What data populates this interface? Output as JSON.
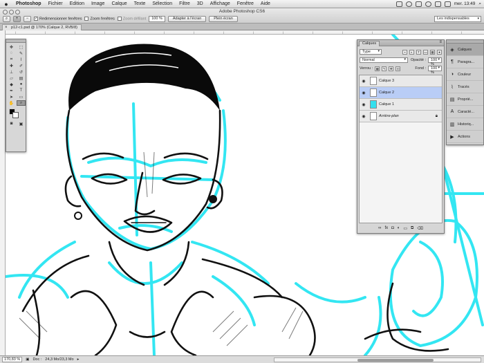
{
  "menubar": {
    "app_name": "Photoshop",
    "items": [
      "Fichier",
      "Edition",
      "Image",
      "Calque",
      "Texte",
      "Sélection",
      "Filtre",
      "3D",
      "Affichage",
      "Fenêtre",
      "Aide"
    ],
    "clock": "mer. 13:49"
  },
  "window": {
    "title": "Adobe Photoshop CS6"
  },
  "options": {
    "resize_windows": "Redimensionner fenêtres",
    "zoom_windows": "Zoom fenêtres",
    "scrubby_zoom": "Zoom défilant",
    "zoom_value": "100 %",
    "fit_screen": "Adapter à l'écran",
    "full_screen": "Plein écran",
    "workspace": "Les indispensables"
  },
  "document": {
    "tab_label": "p12-c1.psd @ 170% (Calque 2, RVB/8)"
  },
  "layers_panel": {
    "tab": "Calques",
    "filter": "Type",
    "blend_mode": "Normal",
    "opacity_label": "Opacité :",
    "opacity_value": "100 %",
    "lock_label": "Verrou :",
    "fill_label": "Fond :",
    "fill_value": "100 %",
    "layers": [
      {
        "name": "Calque 3",
        "selected": false
      },
      {
        "name": "Calque 2",
        "selected": true
      },
      {
        "name": "Calque 1",
        "selected": false
      },
      {
        "name": "Arrière-plan",
        "selected": false
      }
    ]
  },
  "dock": {
    "items": [
      "Calques",
      "Paragra...",
      "Couleur",
      "Tracés",
      "Proprié...",
      "Caracté...",
      "Historiq...",
      "Actions"
    ]
  },
  "status": {
    "zoom": "170,83 %",
    "doc_label": "Doc :",
    "doc_size": "24,3 Mo/23,3 Mo"
  },
  "colors": {
    "sketch_cyan": "#33e6f2",
    "selected_layer": "#b9cdf6"
  }
}
